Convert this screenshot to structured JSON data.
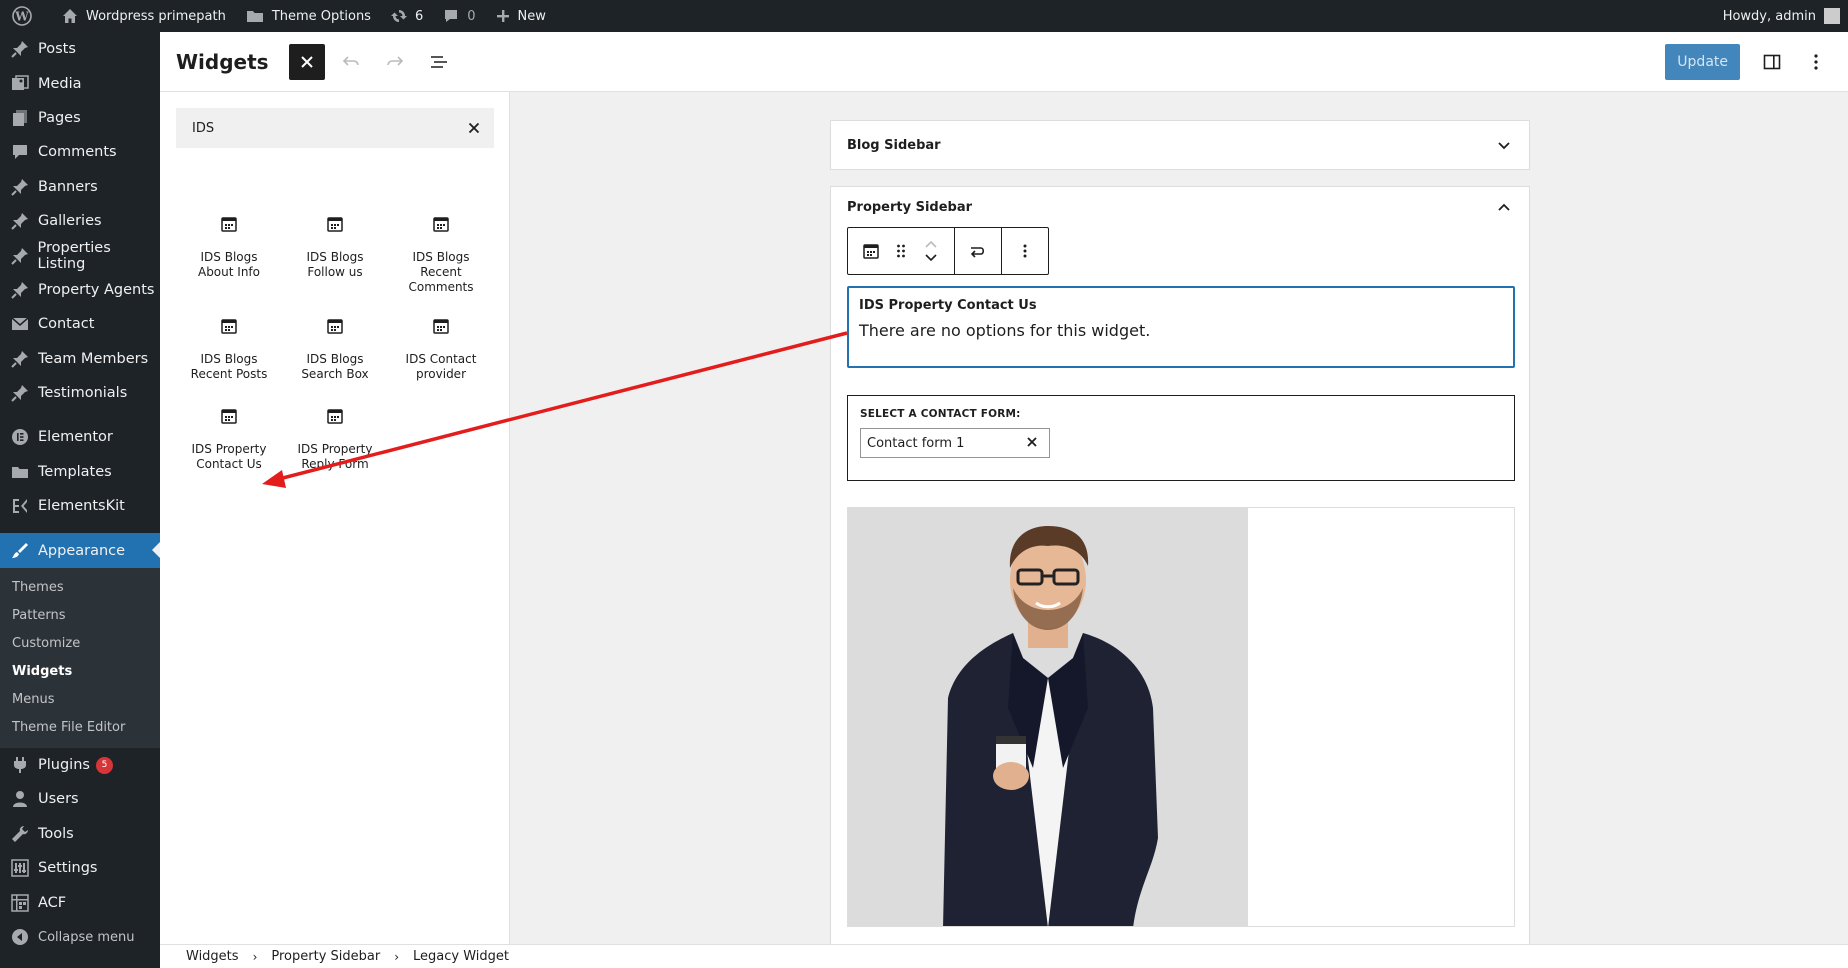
{
  "adminbar": {
    "site_name": "Wordpress primepath",
    "theme_options": "Theme Options",
    "updates_count": "6",
    "comments_count": "0",
    "new_label": "New",
    "howdy": "Howdy, admin"
  },
  "sidebar": {
    "items": [
      {
        "label": "Posts",
        "icon": "pushpin-icon"
      },
      {
        "label": "Media",
        "icon": "media-icon"
      },
      {
        "label": "Pages",
        "icon": "pages-icon"
      },
      {
        "label": "Comments",
        "icon": "comment-icon"
      },
      {
        "label": "Banners",
        "icon": "pushpin-icon"
      },
      {
        "label": "Galleries",
        "icon": "pushpin-icon"
      },
      {
        "label": "Properties Listing",
        "icon": "pushpin-icon"
      },
      {
        "label": "Property Agents",
        "icon": "pushpin-icon"
      },
      {
        "label": "Contact",
        "icon": "email-icon"
      },
      {
        "label": "Team Members",
        "icon": "pushpin-icon"
      },
      {
        "label": "Testimonials",
        "icon": "pushpin-icon"
      }
    ],
    "items2": [
      {
        "label": "Elementor",
        "icon": "elementor-icon"
      },
      {
        "label": "Templates",
        "icon": "folder-icon"
      },
      {
        "label": "ElementsKit",
        "icon": "elementskit-icon"
      }
    ],
    "appearance": "Appearance",
    "submenu": [
      "Themes",
      "Patterns",
      "Customize",
      "Widgets",
      "Menus",
      "Theme File Editor"
    ],
    "items3": [
      {
        "label": "Plugins",
        "icon": "plugin-icon"
      },
      {
        "label": "Users",
        "icon": "users-icon"
      },
      {
        "label": "Tools",
        "icon": "tools-icon"
      },
      {
        "label": "Settings",
        "icon": "settings-icon"
      },
      {
        "label": "ACF",
        "icon": "acf-icon"
      }
    ],
    "plugins_badge": "5",
    "collapse": "Collapse menu"
  },
  "header": {
    "title": "Widgets",
    "update_label": "Update"
  },
  "inserter": {
    "search_value": "IDS",
    "blocks": [
      {
        "line1": "IDS Blogs",
        "line2": "About Info",
        "line3": ""
      },
      {
        "line1": "IDS Blogs",
        "line2": "Follow us",
        "line3": ""
      },
      {
        "line1": "IDS Blogs",
        "line2": "Recent",
        "line3": "Comments"
      },
      {
        "line1": "IDS Blogs",
        "line2": "Recent Posts",
        "line3": ""
      },
      {
        "line1": "IDS Blogs",
        "line2": "Search Box",
        "line3": ""
      },
      {
        "line1": "IDS Contact",
        "line2": "provider",
        "line3": ""
      },
      {
        "line1": "IDS Property",
        "line2": "Contact Us",
        "line3": ""
      },
      {
        "line1": "IDS Property",
        "line2": "Reply Form",
        "line3": ""
      }
    ]
  },
  "canvas": {
    "blog_sidebar": "Blog Sidebar",
    "property_sidebar": "Property Sidebar",
    "legacy_title": "IDS Property Contact Us",
    "legacy_desc": "There are no options for this widget.",
    "cf_label": "SELECT A CONTACT FORM:",
    "cf_value": "Contact form 1"
  },
  "breadcrumb": [
    "Widgets",
    "Property Sidebar",
    "Legacy Widget"
  ],
  "colors": {
    "accent": "#2271b1",
    "arrow": "#e31c1c",
    "admin_dark": "#1d2327"
  }
}
